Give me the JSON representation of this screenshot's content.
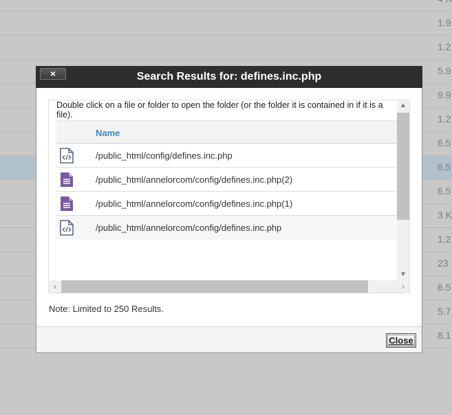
{
  "background": {
    "sizes": [
      "4 K",
      "1.9",
      "1.2",
      "5.9",
      "9.9",
      "1.2",
      "6.5",
      "6.5",
      "6.5",
      "3 K",
      "1.2",
      "23",
      "6.5",
      "5.7",
      "8.1"
    ]
  },
  "dialog": {
    "title": "Search Results for: defines.inc.php",
    "close_x": "×",
    "instructions": "Double click on a file or folder to open the folder (or the folder it is contained in if it is a file).",
    "table": {
      "header": "Name",
      "rows": [
        {
          "icon": "code-file-icon",
          "path": "/public_html/config/defines.inc.php"
        },
        {
          "icon": "text-file-icon",
          "path": "/public_html/annelorcom/config/defines.inc.php(2)"
        },
        {
          "icon": "text-file-icon",
          "path": "/public_html/annelorcom/config/defines.inc.php(1)"
        },
        {
          "icon": "code-file-icon",
          "path": "/public_html/annelorcom/config/defines.inc.php"
        }
      ]
    },
    "note": "Note: Limited to 250 Results.",
    "close_button": "Close"
  },
  "colors": {
    "title_bar": "#2e2e2e",
    "header_text": "#3b88c8",
    "code_icon": "#5a6a8a",
    "text_icon": "#7a5a9a",
    "highlight_row": "#b2c2cc"
  }
}
